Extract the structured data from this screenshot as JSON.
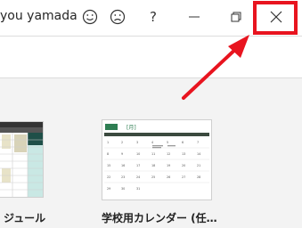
{
  "titlebar": {
    "user_name": "you yamada",
    "smiley_icon": "smiley-face-icon",
    "frown_icon": "frowning-face-icon",
    "help_label": "?",
    "minimize_icon": "minimize-icon",
    "restore_icon": "restore-icon",
    "close_icon": "close-icon"
  },
  "templates": [
    {
      "caption": "ジュール"
    },
    {
      "caption": "学校用カレンダー (任…",
      "month_label": "[月]"
    }
  ],
  "annotation": {
    "color": "#e8141f"
  }
}
